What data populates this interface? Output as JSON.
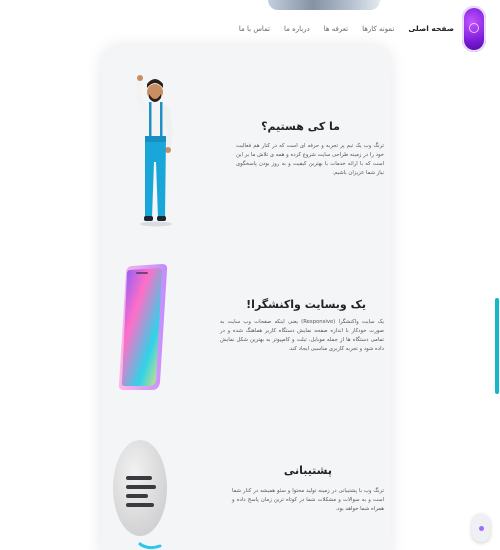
{
  "nav": {
    "logo_icon": "brand-logo-icon",
    "links": [
      "صفحه اصلی",
      "نمونه کارها",
      "تعرفه ها",
      "درباره ما",
      "تماس با ما"
    ]
  },
  "sections": [
    {
      "title": "ما کی هستیم؟",
      "body": "ترنگ وب یک تیم پر تجربه و حرفه ای است که در کنار هم فعالیت خود را در زمینه طراحی سایت شروع کرده و همه ی تلاش ما بر این است که با ارائه خدمات با بهترین کیفیت و به روز بودن پاسخگوی نیاز شما عزیزان باشیم.",
      "illustration": "waving-man-illustration"
    },
    {
      "title": "یک وبسایت واکنشگرا!",
      "body": "یک سایت واکنشگرا (Responsive) یعنی اینکه صفحات وب سایت به صورت خودکار با اندازه صفحه نمایش دستگاه کاربر هماهنگ شده و در تمامی دستگاه ها از جمله موبایل، تبلت و کامپیوتر به بهترین شکل نمایش داده شود و تجربه کاربری مناسبی ایجاد کند.",
      "illustration": "gradient-phone-illustration"
    },
    {
      "title": "پشتیبانی",
      "body": "ترنگ وب با پشتیبانی در زمینه تولید محتوا و سئو همیشه در کنار شما است و به سوالات و مشکلات شما در کوتاه ترین زمان پاسخ داده و همراه شما خواهد بود.",
      "illustration": "chat-bubble-illustration"
    }
  ],
  "colors": {
    "accent": "#14b8c7",
    "brand": "#7a1ad8",
    "card_bg": "#f4f5f7"
  }
}
